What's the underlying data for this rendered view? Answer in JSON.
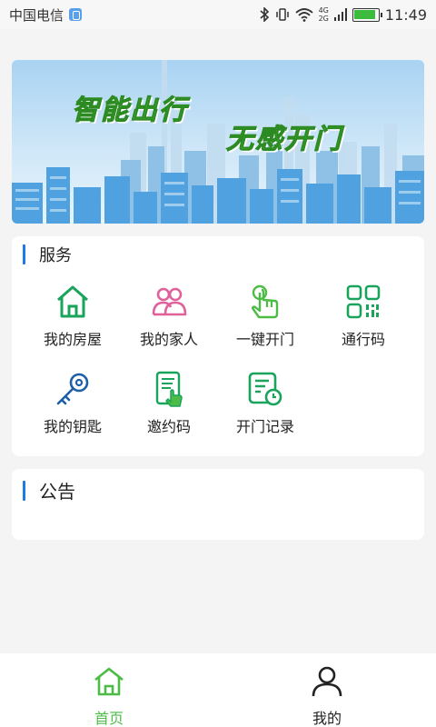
{
  "status_bar": {
    "carrier": "中国电信",
    "network_top": "4G",
    "network_bottom": "2G",
    "time": "11:49",
    "icons": [
      "sim-badge-icon",
      "bluetooth-icon",
      "vibrate-icon",
      "wifi-icon",
      "signal-icon",
      "battery-icon"
    ],
    "battery_level": 0.9
  },
  "banner": {
    "text_1": "智能出行",
    "text_2": "无感开门"
  },
  "services": {
    "title": "服务",
    "items": [
      {
        "label": "我的房屋",
        "icon": "house-icon",
        "color": "#1aa35a"
      },
      {
        "label": "我的家人",
        "icon": "family-icon",
        "color": "#e0609a"
      },
      {
        "label": "一键开门",
        "icon": "tap-icon",
        "color": "#4cbc47"
      },
      {
        "label": "通行码",
        "icon": "qr-code-icon",
        "color": "#1aa35a"
      },
      {
        "label": "我的钥匙",
        "icon": "key-icon",
        "color": "#1b5fa8"
      },
      {
        "label": "邀约码",
        "icon": "invite-phone-icon",
        "color": "#1aa35a"
      },
      {
        "label": "开门记录",
        "icon": "record-clock-icon",
        "color": "#1aa35a"
      }
    ]
  },
  "notice": {
    "title": "公告"
  },
  "tabbar": {
    "tabs": [
      {
        "label": "首页",
        "icon": "home-tab-icon",
        "active": true,
        "color": "#4cbc47"
      },
      {
        "label": "我的",
        "icon": "person-tab-icon",
        "active": false,
        "color": "#222222"
      }
    ]
  }
}
